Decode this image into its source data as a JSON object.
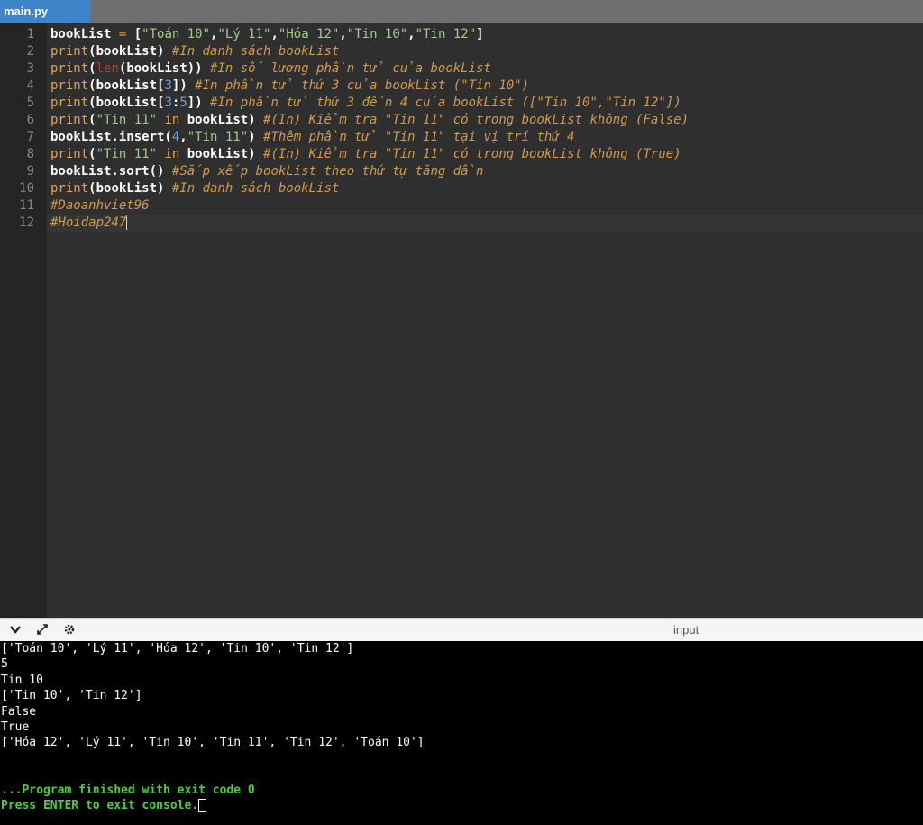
{
  "tab": {
    "label": "main.py"
  },
  "editor": {
    "lines": [
      {
        "number": "1",
        "tokens": [
          {
            "t": "bookList",
            "c": "name"
          },
          {
            "t": " = ",
            "c": "op"
          },
          {
            "t": "[",
            "c": "name"
          },
          {
            "t": "\"Toán 10\"",
            "c": "str"
          },
          {
            "t": ",",
            "c": "name"
          },
          {
            "t": "\"Lý 11\"",
            "c": "str"
          },
          {
            "t": ",",
            "c": "name"
          },
          {
            "t": "\"Hóa 12\"",
            "c": "str"
          },
          {
            "t": ",",
            "c": "name"
          },
          {
            "t": "\"Tin 10\"",
            "c": "str"
          },
          {
            "t": ",",
            "c": "name"
          },
          {
            "t": "\"Tin 12\"",
            "c": "str"
          },
          {
            "t": "]",
            "c": "name"
          }
        ]
      },
      {
        "number": "2",
        "tokens": [
          {
            "t": "print",
            "c": "kw"
          },
          {
            "t": "(bookList)",
            "c": "name"
          },
          {
            "t": " #In danh sách bookList",
            "c": "cmt"
          }
        ]
      },
      {
        "number": "3",
        "tokens": [
          {
            "t": "print",
            "c": "kw"
          },
          {
            "t": "(",
            "c": "name"
          },
          {
            "t": "len",
            "c": "bi"
          },
          {
            "t": "(bookList))",
            "c": "name"
          },
          {
            "t": " #In số lượng phần tử của bookList",
            "c": "cmt"
          }
        ]
      },
      {
        "number": "4",
        "tokens": [
          {
            "t": "print",
            "c": "kw"
          },
          {
            "t": "(bookList[",
            "c": "name"
          },
          {
            "t": "3",
            "c": "num"
          },
          {
            "t": "])",
            "c": "name"
          },
          {
            "t": " #In phần tử thứ 3 của bookList (\"Tin 10\")",
            "c": "cmt"
          }
        ]
      },
      {
        "number": "5",
        "tokens": [
          {
            "t": "print",
            "c": "kw"
          },
          {
            "t": "(bookList[",
            "c": "name"
          },
          {
            "t": "3",
            "c": "num"
          },
          {
            "t": ":",
            "c": "name"
          },
          {
            "t": "5",
            "c": "num"
          },
          {
            "t": "])",
            "c": "name"
          },
          {
            "t": " #In phần tử thứ 3 đến 4 của bookList ([\"Tin 10\",\"Tin 12\"])",
            "c": "cmt"
          }
        ]
      },
      {
        "number": "6",
        "tokens": [
          {
            "t": "print",
            "c": "kw"
          },
          {
            "t": "(",
            "c": "name"
          },
          {
            "t": "\"Tin 11\"",
            "c": "str"
          },
          {
            "t": " in ",
            "c": "kw"
          },
          {
            "t": "bookList)",
            "c": "name"
          },
          {
            "t": " #(In) Kiểm tra \"Tin 11\" có trong bookList không (False)",
            "c": "cmt"
          }
        ]
      },
      {
        "number": "7",
        "tokens": [
          {
            "t": "bookList.insert(",
            "c": "name"
          },
          {
            "t": "4",
            "c": "num"
          },
          {
            "t": ",",
            "c": "name"
          },
          {
            "t": "\"Tin 11\"",
            "c": "str"
          },
          {
            "t": ")",
            "c": "name"
          },
          {
            "t": " #Thêm phần tử \"Tin 11\" tại vị trí thứ 4",
            "c": "cmt"
          }
        ]
      },
      {
        "number": "8",
        "tokens": [
          {
            "t": "print",
            "c": "kw"
          },
          {
            "t": "(",
            "c": "name"
          },
          {
            "t": "\"Tin 11\"",
            "c": "str"
          },
          {
            "t": " in ",
            "c": "kw"
          },
          {
            "t": "bookList)",
            "c": "name"
          },
          {
            "t": " #(In) Kiểm tra \"Tin 11\" có trong bookList không (True)",
            "c": "cmt"
          }
        ]
      },
      {
        "number": "9",
        "tokens": [
          {
            "t": "bookList.sort()",
            "c": "name"
          },
          {
            "t": " #Sắp xếp bookList theo thứ tự tăng dần",
            "c": "cmt"
          }
        ]
      },
      {
        "number": "10",
        "tokens": [
          {
            "t": "print",
            "c": "kw"
          },
          {
            "t": "(bookList)",
            "c": "name"
          },
          {
            "t": " #In danh sách bookList",
            "c": "cmt"
          }
        ]
      },
      {
        "number": "11",
        "tokens": [
          {
            "t": "#Daoanhviet96",
            "c": "cmt"
          }
        ]
      },
      {
        "number": "12",
        "tokens": [
          {
            "t": "#Hoidap247",
            "c": "cmt"
          }
        ]
      }
    ]
  },
  "console_toolbar": {
    "input_label": "input",
    "icons": [
      "chevron-down-icon",
      "expand-icon",
      "settings-icon"
    ]
  },
  "console": {
    "output": [
      "['Toán 10', 'Lý 11', 'Hóa 12', 'Tin 10', 'Tin 12']",
      "5",
      "Tin 10",
      "['Tin 10', 'Tin 12']",
      "False",
      "True",
      "['Hóa 12', 'Lý 11', 'Tin 10', 'Tin 11', 'Tin 12', 'Toán 10']",
      "",
      "",
      "...Program finished with exit code 0",
      "Press ENTER to exit console."
    ]
  },
  "colors": {
    "tab_active": "#3e84c8",
    "editor_bg": "#2f2f2f",
    "console_bg": "#000000",
    "console_finish": "#4cd137"
  }
}
